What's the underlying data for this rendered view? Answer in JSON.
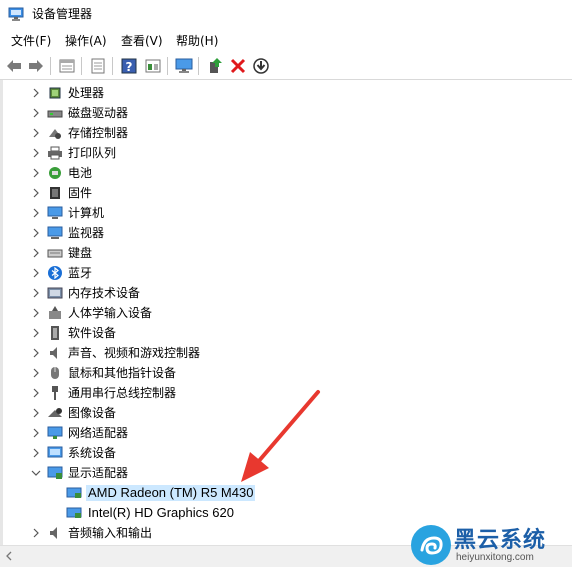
{
  "window": {
    "title": "设备管理器"
  },
  "menu": [
    {
      "label": "文件(F)"
    },
    {
      "label": "操作(A)"
    },
    {
      "label": "查看(V)"
    },
    {
      "label": "帮助(H)"
    }
  ],
  "toolbar": {
    "buttons": [
      "back-arrow-icon",
      "forward-arrow-icon",
      "properties-icon",
      "properties-sheet-icon",
      "help-icon",
      "view-resources-icon",
      "monitor-scan-icon",
      "update-driver-icon",
      "uninstall-x-icon",
      "download-icon"
    ]
  },
  "tree": {
    "categories": [
      {
        "label": "处理器",
        "icon": "cpu-icon"
      },
      {
        "label": "磁盘驱动器",
        "icon": "disk-icon"
      },
      {
        "label": "存储控制器",
        "icon": "storage-controller-icon"
      },
      {
        "label": "打印队列",
        "icon": "printer-icon"
      },
      {
        "label": "电池",
        "icon": "battery-icon"
      },
      {
        "label": "固件",
        "icon": "firmware-icon"
      },
      {
        "label": "计算机",
        "icon": "computer-icon"
      },
      {
        "label": "监视器",
        "icon": "monitor-icon"
      },
      {
        "label": "键盘",
        "icon": "keyboard-icon"
      },
      {
        "label": "蓝牙",
        "icon": "bluetooth-icon"
      },
      {
        "label": "内存技术设备",
        "icon": "memory-icon"
      },
      {
        "label": "人体学输入设备",
        "icon": "hid-icon"
      },
      {
        "label": "软件设备",
        "icon": "software-device-icon"
      },
      {
        "label": "声音、视频和游戏控制器",
        "icon": "speaker-icon"
      },
      {
        "label": "鼠标和其他指针设备",
        "icon": "mouse-icon"
      },
      {
        "label": "通用串行总线控制器",
        "icon": "usb-icon"
      },
      {
        "label": "图像设备",
        "icon": "camera-icon"
      },
      {
        "label": "网络适配器",
        "icon": "network-adapter-icon"
      },
      {
        "label": "系统设备",
        "icon": "system-device-icon"
      },
      {
        "label": "显示适配器",
        "icon": "display-adapter-icon",
        "expanded": true
      }
    ],
    "display_children": [
      {
        "label": "AMD Radeon (TM) R5 M430",
        "selected": true
      },
      {
        "label": "Intel(R) HD Graphics 620"
      }
    ],
    "last": {
      "label": "音频输入和输出",
      "icon": "audio-io-icon"
    }
  },
  "watermark": {
    "brand": "黑云系统",
    "url": "heiyunxitong.com"
  },
  "colors": {
    "selection": "#cce8ff",
    "arrow": "#e8382f",
    "brand": "#1c5fa8"
  }
}
